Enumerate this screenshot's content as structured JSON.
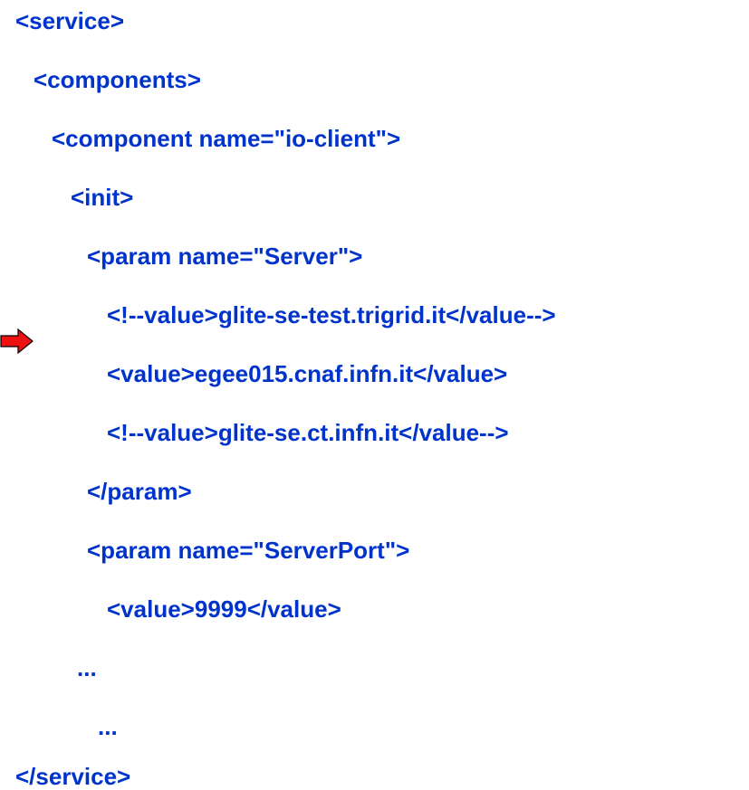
{
  "colors": {
    "text": "#0033cc",
    "arrow_fill": "#ee1111",
    "arrow_stroke": "#000000"
  },
  "indicator": {
    "icon": "red-arrow-right-icon"
  },
  "lines": [
    "<service>",
    "<components>",
    "<component name=\"io-client\">",
    "<init>",
    "<param name=\"Server\">",
    "<!--value>glite-se-test.trigrid.it</value-->",
    "<value>egee015.cnaf.infn.it</value>",
    "<!--value>glite-se.ct.infn.it</value-->",
    "</param>",
    "<param name=\"ServerPort\">",
    "<value>9999</value>",
    "...",
    "...",
    "</service>"
  ]
}
